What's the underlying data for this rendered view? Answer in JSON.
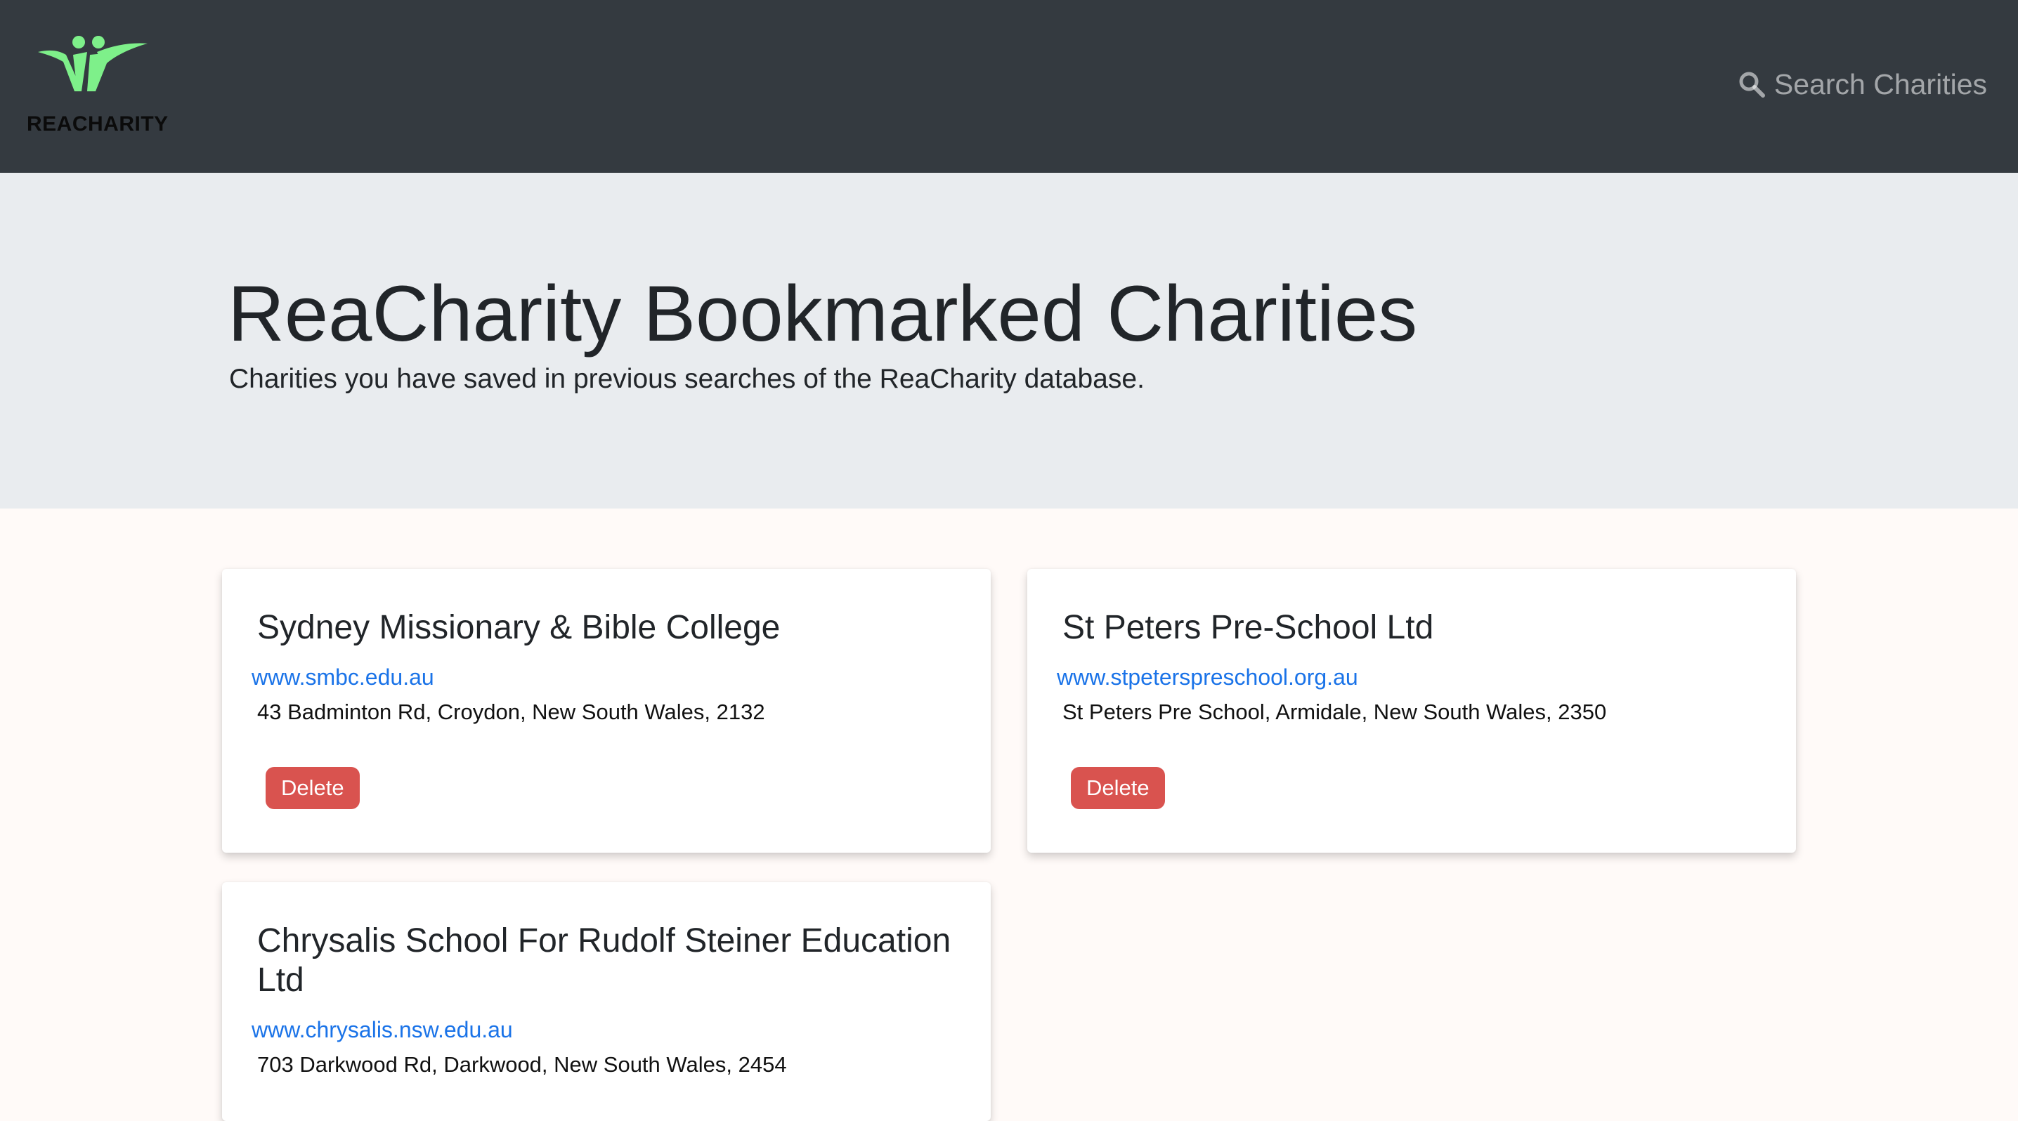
{
  "brand": {
    "name": "REACHARITY",
    "logo_color": "#7ef08a"
  },
  "nav": {
    "search_label": "Search Charities"
  },
  "jumbotron": {
    "title": "ReaCharity Bookmarked Charities",
    "lead": "Charities you have saved in previous searches of the ReaCharity database."
  },
  "bookmarks": [
    {
      "name": "Sydney Missionary & Bible College",
      "website": "www.smbc.edu.au",
      "address": "43 Badminton Rd, Croydon, New South Wales, 2132",
      "delete_label": "Delete"
    },
    {
      "name": "St Peters Pre-School Ltd",
      "website": "www.stpeterspreschool.org.au",
      "address": "St Peters Pre School, Armidale, New South Wales, 2350",
      "delete_label": "Delete"
    },
    {
      "name": "Chrysalis School For Rudolf Steiner Education Ltd",
      "website": "www.chrysalis.nsw.edu.au",
      "address": "703 Darkwood Rd, Darkwood, New South Wales, 2454"
    }
  ],
  "colors": {
    "navbar_bg": "#343a40",
    "jumbotron_bg": "#e9ecef",
    "page_bg": "#fffaf8",
    "link": "#1a73e8",
    "delete_button": "#d9534f"
  }
}
